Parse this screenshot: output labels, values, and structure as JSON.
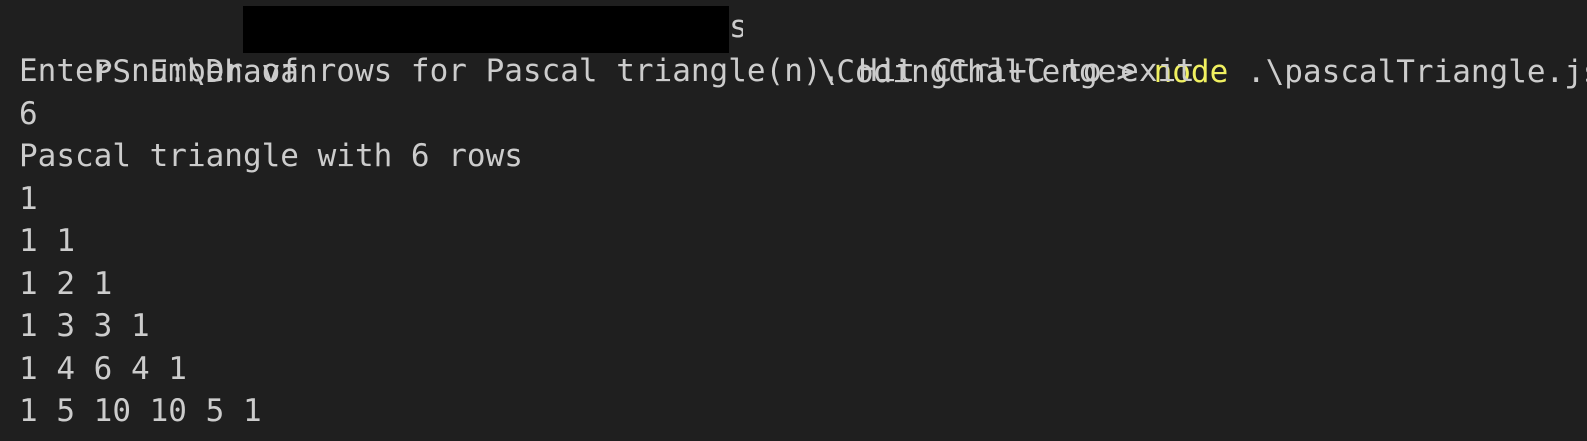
{
  "terminal": {
    "prompt_prefix": "PS E:\\Dhavan",
    "prompt_suffix_glyph": "s",
    "prompt_suffix": "\\CodingChallenge> ",
    "command": "node",
    "command_args": " .\\pascalTriangle.js",
    "instruction": "Enter number of rows for Pascal triangle(n). Hit Ctrl+C to exit",
    "user_input": "6",
    "result_header": "Pascal triangle with 6 rows",
    "rows": [
      "1",
      "1 1",
      "1 2 1",
      "1 3 3 1",
      "1 4 6 4 1",
      "1 5 10 10 5 1"
    ]
  },
  "colors": {
    "background": "#1f1f1f",
    "text": "#cccccc",
    "command": "#f0f060",
    "redaction": "#000000"
  }
}
